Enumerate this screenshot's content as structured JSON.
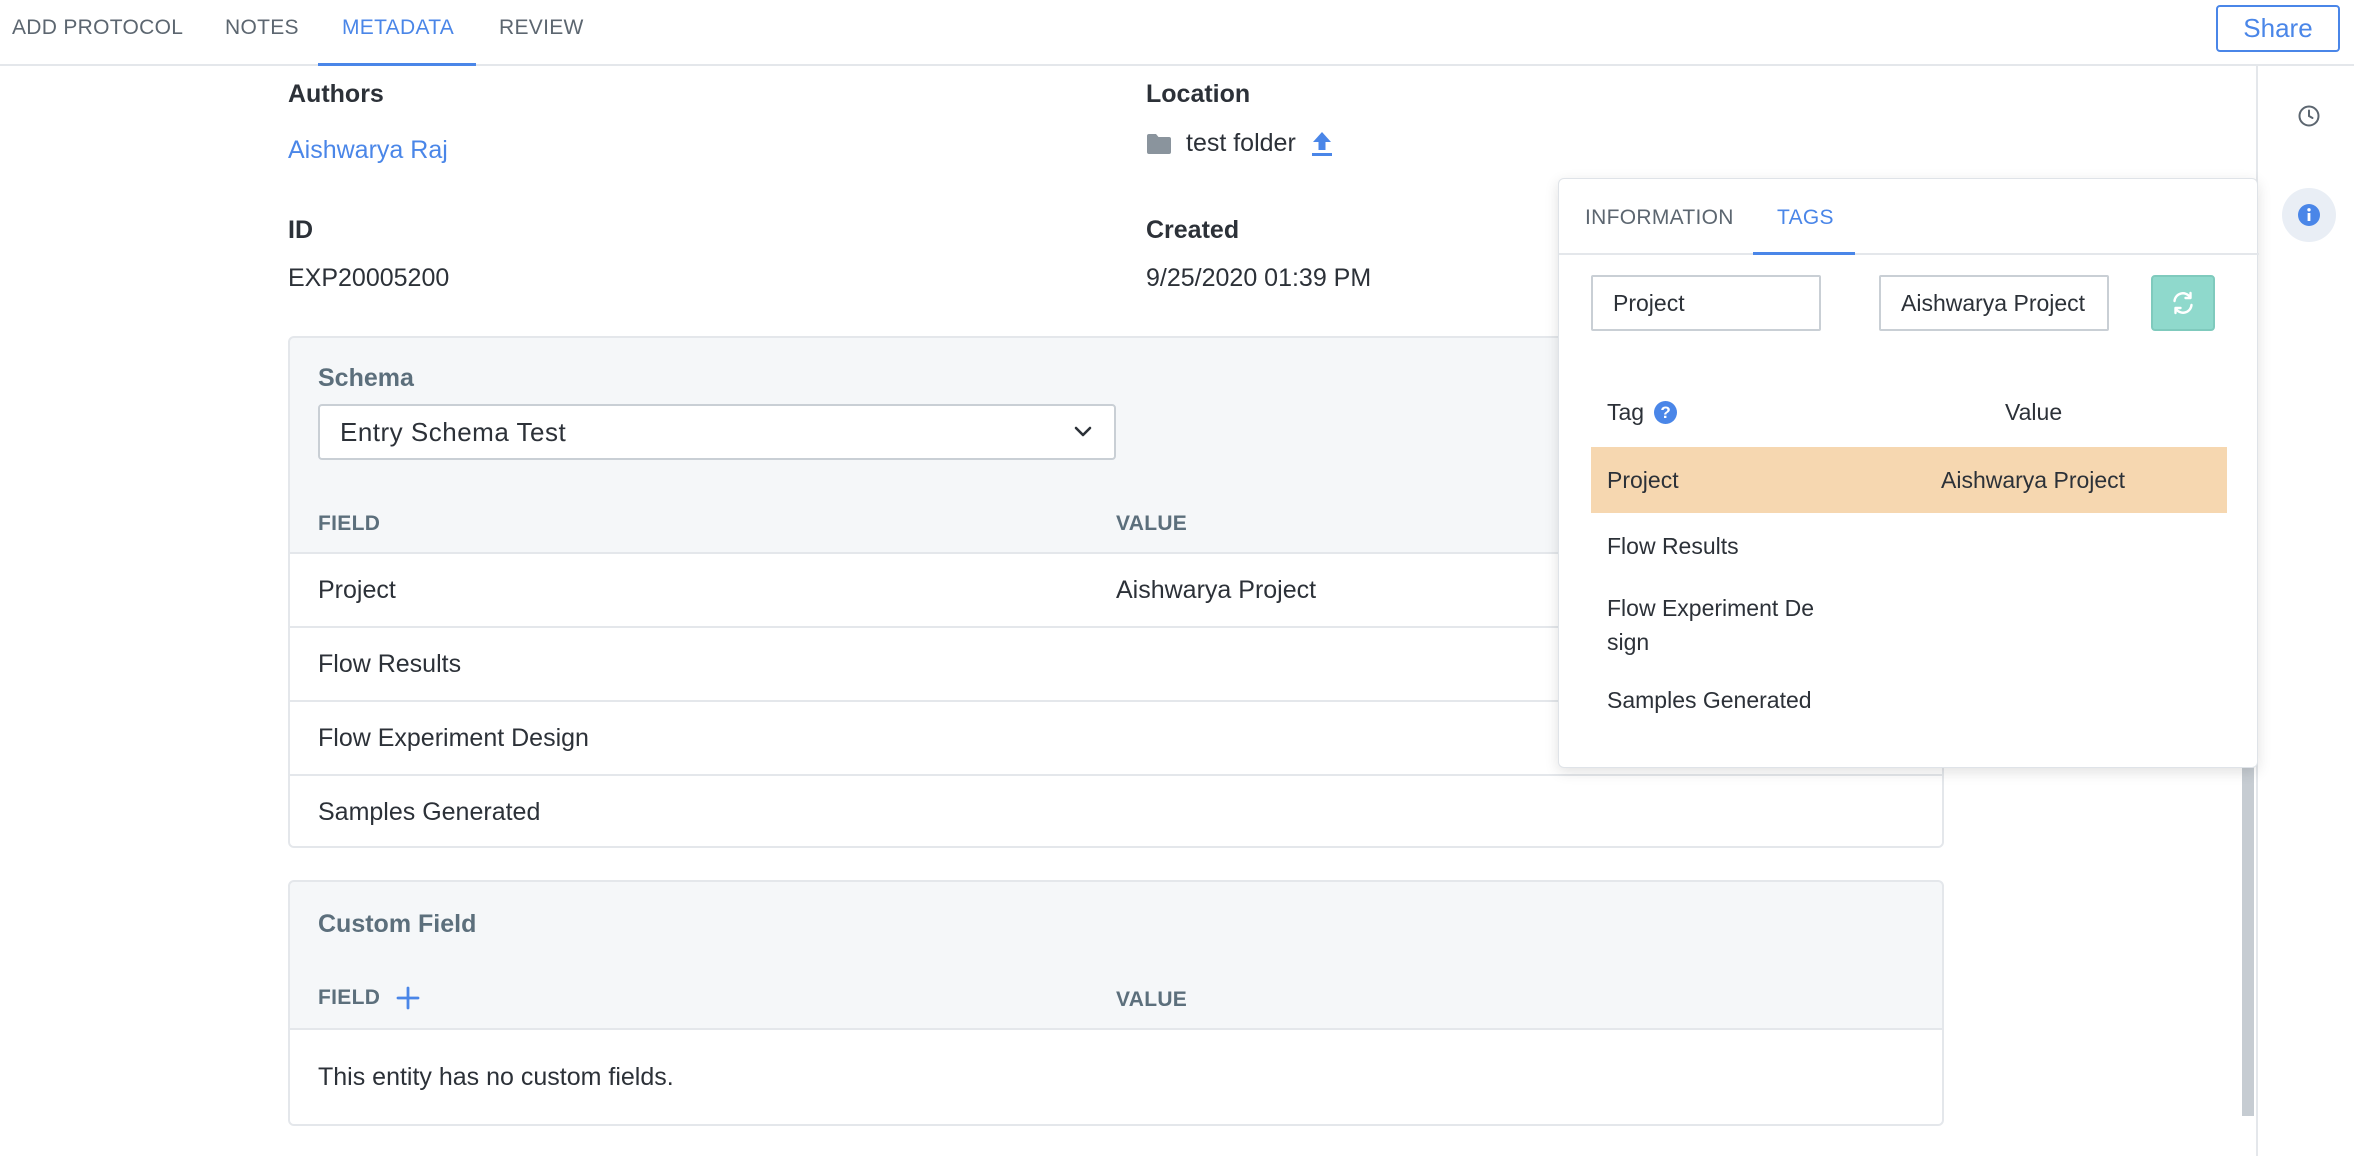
{
  "tabs": [
    {
      "label": "ADD PROTOCOL",
      "active": false
    },
    {
      "label": "NOTES",
      "active": false
    },
    {
      "label": "METADATA",
      "active": true
    },
    {
      "label": "REVIEW",
      "active": false
    }
  ],
  "share_label": "Share",
  "meta": {
    "authors_label": "Authors",
    "author_name": "Aishwarya Raj",
    "location_label": "Location",
    "location_value": "test folder",
    "id_label": "ID",
    "id_value": "EXP20005200",
    "created_label": "Created",
    "created_value": "9/25/2020 01:39 PM"
  },
  "schema": {
    "title": "Schema",
    "selected": "Entry Schema Test",
    "col_field": "FIELD",
    "col_value": "VALUE",
    "rows": [
      {
        "field": "Project",
        "value": "Aishwarya Project"
      },
      {
        "field": "Flow Results",
        "value": ""
      },
      {
        "field": "Flow Experiment Design",
        "value": ""
      },
      {
        "field": "Samples Generated",
        "value": ""
      }
    ]
  },
  "custom": {
    "title": "Custom Field",
    "col_field": "FIELD",
    "col_value": "VALUE",
    "empty_text": "This entity has no custom fields."
  },
  "tags_panel": {
    "tabs": [
      {
        "label": "INFORMATION",
        "active": false
      },
      {
        "label": "TAGS",
        "active": true
      }
    ],
    "tag_input": "Project",
    "value_input": "Aishwarya Project",
    "col_tag": "Tag",
    "col_value": "Value",
    "rows": [
      {
        "tag": "Project",
        "value": "Aishwarya Project",
        "highlighted": true
      },
      {
        "tag": "Flow Results",
        "value": "",
        "highlighted": false
      },
      {
        "tag": "Flow Experiment De\nsign",
        "value": "",
        "highlighted": false
      },
      {
        "tag": "Samples Generated",
        "value": "",
        "highlighted": false
      }
    ]
  },
  "colors": {
    "accent": "#4a86e8",
    "highlight_row": "#f6d7b0",
    "refresh_button": "#8fd9cc"
  },
  "icons": [
    "folder-icon",
    "upload-icon",
    "chevron-down-icon",
    "plus-icon",
    "refresh-icon",
    "help-icon",
    "clock-icon",
    "info-icon"
  ]
}
